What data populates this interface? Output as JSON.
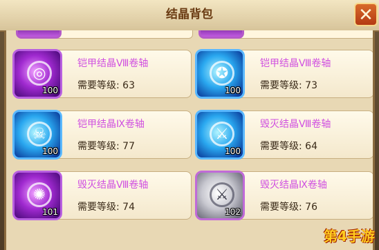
{
  "window": {
    "title": "结晶背包",
    "close_label": "✕"
  },
  "level_prefix": "需要等级: ",
  "items": [
    {
      "name": "铠甲结晶Ⅷ卷轴",
      "level": "63",
      "count": "100",
      "color": "purple",
      "glyph": "◎"
    },
    {
      "name": "铠甲结晶Ⅷ卷轴",
      "level": "73",
      "count": "100",
      "color": "blue",
      "glyph": "✪"
    },
    {
      "name": "铠甲结晶Ⅸ卷轴",
      "level": "77",
      "count": "100",
      "color": "blue",
      "glyph": "☠"
    },
    {
      "name": "毁灭结晶Ⅷ卷轴",
      "level": "64",
      "count": "100",
      "color": "blue",
      "glyph": "⚔"
    },
    {
      "name": "毁灭结晶Ⅷ卷轴",
      "level": "74",
      "count": "101",
      "color": "purple",
      "glyph": "✺"
    },
    {
      "name": "毁灭结晶Ⅸ卷轴",
      "level": "76",
      "count": "102",
      "color": "silver",
      "glyph": "⚔"
    }
  ],
  "watermark": "第4手游"
}
